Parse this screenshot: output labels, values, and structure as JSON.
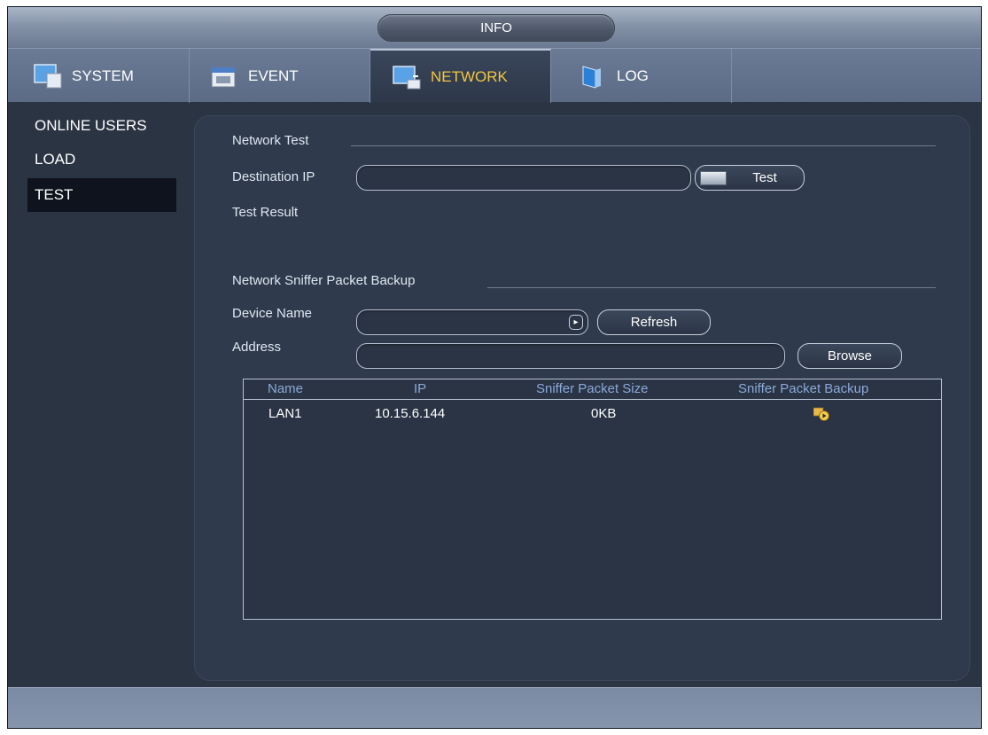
{
  "window": {
    "title": "INFO"
  },
  "tabs": [
    {
      "label": "SYSTEM",
      "icon": "system-icon"
    },
    {
      "label": "EVENT",
      "icon": "event-icon"
    },
    {
      "label": "NETWORK",
      "icon": "network-icon",
      "active": true
    },
    {
      "label": "LOG",
      "icon": "log-icon"
    }
  ],
  "sidebar": {
    "items": [
      {
        "label": "ONLINE USERS"
      },
      {
        "label": "LOAD"
      },
      {
        "label": "TEST",
        "active": true
      }
    ]
  },
  "network_test": {
    "section_title": "Network Test",
    "destination_ip_label": "Destination IP",
    "destination_ip_value": "",
    "test_button": "Test",
    "result_label": "Test Result"
  },
  "sniffer": {
    "section_title": "Network Sniffer Packet Backup",
    "device_name_label": "Device Name",
    "device_name_value": "",
    "refresh_button": "Refresh",
    "address_label": "Address",
    "address_value": "",
    "browse_button": "Browse",
    "table": {
      "columns": [
        "Name",
        "IP",
        "Sniffer Packet Size",
        "Sniffer Packet Backup"
      ],
      "rows": [
        {
          "name": "LAN1",
          "ip": "10.15.6.144",
          "size": "0KB",
          "backup_icon": "backup-play-icon"
        }
      ]
    }
  },
  "colors": {
    "accent_active_tab": "#f2c63d",
    "panel_bg": "#2f3a4c",
    "header_text": "#8ba9d8"
  }
}
